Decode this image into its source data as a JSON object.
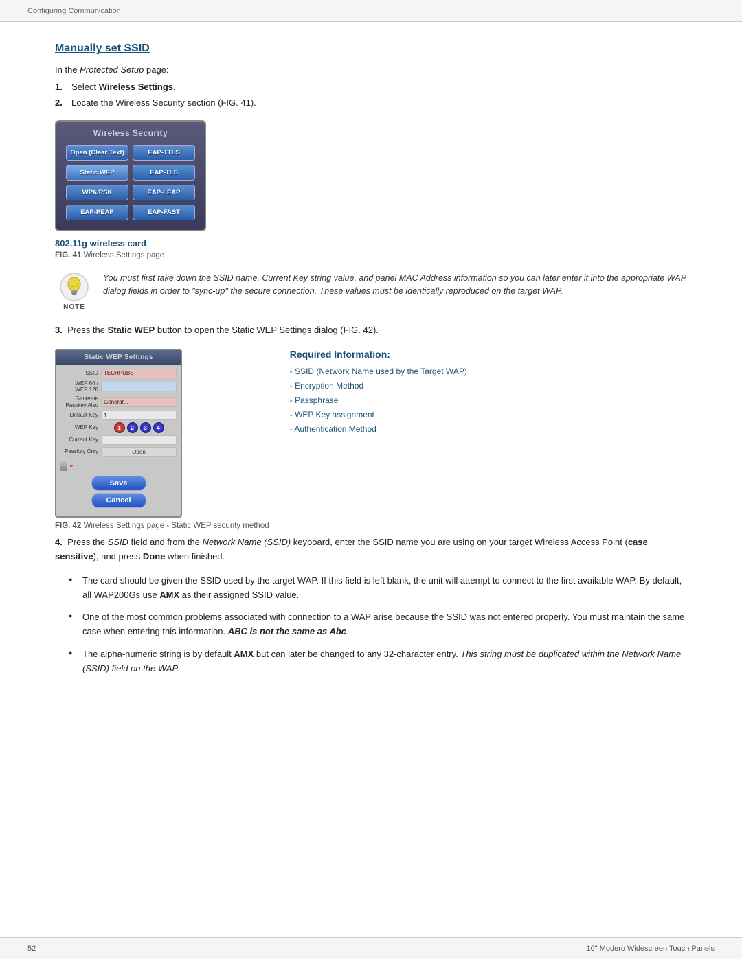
{
  "header": {
    "text": "Configuring Communication"
  },
  "footer": {
    "page_number": "52",
    "product_name": "10\" Modero Widescreen Touch Panels"
  },
  "section": {
    "heading": "Manually set SSID",
    "intro": "In the Protected Setup page:",
    "steps": [
      {
        "num": "1.",
        "text": "Select Wireless Settings."
      },
      {
        "num": "2.",
        "text": "Locate the Wireless Security section (FIG. 41)."
      }
    ]
  },
  "wireless_security_panel": {
    "title": "Wireless Security",
    "buttons": [
      "Open (Clear Text)",
      "EAP-TTLS",
      "Static WEP",
      "EAP-TLS",
      "WPA/PSK",
      "EAP-LEAP",
      "EAP-PEAP",
      "EAP-FAST"
    ],
    "caption_bold": "802.11g wireless card",
    "fig_label": "FIG. 41",
    "fig_caption": "Wireless Settings page"
  },
  "note": {
    "label": "NOTE",
    "text": "You must first take down the SSID name, Current Key string value, and panel MAC Address information so you can later enter it into the appropriate WAP dialog fields in order to \"sync-up\" the secure connection. These values must be identically reproduced on the target WAP."
  },
  "step3": {
    "num": "3.",
    "text_pre": "Press the ",
    "text_bold": "Static WEP",
    "text_post": " button to open the Static WEP Settings dialog (FIG. 42)."
  },
  "wep_panel": {
    "title": "Static WEP Settings",
    "rows": [
      {
        "label": "SSID",
        "value": "TECHPUBS",
        "style": "pink"
      },
      {
        "label": "WEP 64 / WEP 128",
        "value": "",
        "style": "blue"
      },
      {
        "label": "Generate Passkey Also",
        "value": "Generat...",
        "style": "pink"
      },
      {
        "label": "Default Key",
        "value": "1",
        "style": "light"
      }
    ],
    "wep_key_label": "WEP Key",
    "key_buttons": [
      "1",
      "2",
      "3",
      "4"
    ],
    "current_key_label": "Current Key",
    "passkey_label": "Passkey Only",
    "open_value": "Open",
    "save_label": "Save",
    "cancel_label": "Cancel",
    "fig_label": "FIG. 42",
    "fig_caption": "Wireless Settings page - Static WEP security method"
  },
  "required_info": {
    "title": "Required Information:",
    "items": [
      "SSID (Network Name used by the Target WAP)",
      "Encryption Method",
      "Passphrase",
      "WEP Key assignment",
      "Authentication Method"
    ]
  },
  "step4": {
    "num": "4.",
    "text": "Press the SSID field and from the Network Name (SSID) keyboard, enter the SSID name you are using on your target Wireless Access Point (case sensitive), and press Done when finished."
  },
  "bullets": [
    "The card should be given the SSID used by the target WAP. If this field is left blank, the unit will attempt to connect to the first available WAP. By default, all WAP200Gs use AMX as their assigned SSID value.",
    "One of the most common problems associated with connection to a WAP arise because the SSID was not entered properly. You must maintain the same case when entering this information. ABC is not the same as Abc.",
    "The alpha-numeric string is by default AMX but can later be changed to any 32-character entry. This string must be duplicated within the Network Name (SSID) field on the WAP."
  ]
}
